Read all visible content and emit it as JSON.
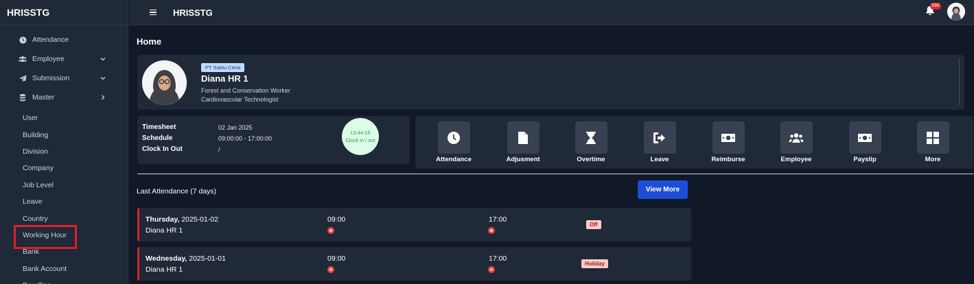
{
  "app": {
    "brand": "HRISSTG",
    "top_title": "HRISSTG",
    "notification_count": "590"
  },
  "sidebar": {
    "main_items": [
      {
        "label": "Attendance",
        "icon": "clock-icon"
      },
      {
        "label": "Employee",
        "icon": "users-icon",
        "chevron": "down"
      },
      {
        "label": "Submission",
        "icon": "paper-plane-icon",
        "chevron": "down"
      },
      {
        "label": "Master",
        "icon": "database-icon",
        "chevron": "right"
      }
    ],
    "sub_items": [
      "User",
      "Building",
      "Division",
      "Company",
      "Job Level",
      "Leave",
      "Country",
      "Working Hour",
      "Bank",
      "Bank Account",
      "Deadline"
    ],
    "highlighted": "Working Hour",
    "highlight_color": "#e11d2a"
  },
  "page": {
    "title": "Home"
  },
  "profile": {
    "company": "PT Sabtu Ceria",
    "name": "Diana HR 1",
    "job1": "Forest and Conservation Worker",
    "job2": "Cardiovascular Technologist"
  },
  "timesheet": {
    "timesheet_label": "Timesheet",
    "timesheet_value": "02 Jan 2025",
    "schedule_label": "Schedule",
    "schedule_value": "09:00:00 - 17:00:00",
    "clock_label": "Clock In Out",
    "clock_value": "/",
    "clock_time": "13:44:15",
    "clock_action": "Clock in / out"
  },
  "quick_actions": [
    {
      "label": "Attendance",
      "icon": "clock-icon"
    },
    {
      "label": "Adjusment",
      "icon": "file-icon"
    },
    {
      "label": "Overtime",
      "icon": "hourglass-icon"
    },
    {
      "label": "Leave",
      "icon": "sign-out-icon"
    },
    {
      "label": "Reimburse",
      "icon": "money-bill-icon"
    },
    {
      "label": "Employee",
      "icon": "users-icon"
    },
    {
      "label": "Payslip",
      "icon": "money-bill-icon"
    },
    {
      "label": "More",
      "icon": "grid-icon"
    }
  ],
  "last_attendance": {
    "title": "Last Attendance (7 days)",
    "view_more": "View More",
    "rows": [
      {
        "day": "Thursday,",
        "date": "2025-01-02",
        "name": "Diana HR 1",
        "in": "09:00",
        "out": "17:00",
        "status": "Off"
      },
      {
        "day": "Wednesday,",
        "date": "2025-01-01",
        "name": "Diana HR 1",
        "in": "09:00",
        "out": "17:00",
        "status": "Holiday"
      }
    ]
  }
}
